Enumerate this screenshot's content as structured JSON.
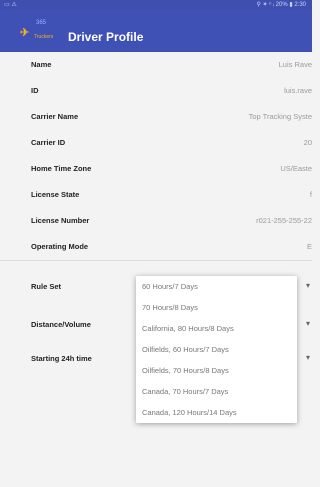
{
  "status_bar": {
    "left": "▭ ⚠",
    "right": "⚲ ✶ ⁿ ᵢ 20% ▮ 2:30"
  },
  "app_bar": {
    "title": "Driver Profile",
    "logo": {
      "top_text": "365",
      "bottom_text": "Truckers"
    }
  },
  "profile_rows": [
    {
      "label": "Name",
      "value": "Luis Rave"
    },
    {
      "label": "ID",
      "value": "luis.rave"
    },
    {
      "label": "Carrier Name",
      "value": "Top Tracking Syste"
    },
    {
      "label": "Carrier ID",
      "value": "20"
    },
    {
      "label": "Home Time Zone",
      "value": "US/Easte"
    },
    {
      "label": "License State",
      "value": "f"
    },
    {
      "label": "License Number",
      "value": "r021-255-255-22"
    },
    {
      "label": "Operating Mode",
      "value": "E"
    }
  ],
  "select_rows": [
    {
      "label": "Rule Set",
      "chevron": "▾"
    },
    {
      "label": "Distance/Volume",
      "chevron": "▾"
    },
    {
      "label": "Starting 24h time",
      "chevron": "▾"
    }
  ],
  "rule_set_options": [
    "60 Hours/7 Days",
    "70 Hours/8 Days",
    "California, 80 Hours/8 Days",
    "Oilfields, 60 Hours/7 Days",
    "Oilfields, 70 Hours/8 Days",
    "Canada, 70 Hours/7 Days",
    "Canada, 120 Hours/14 Days"
  ],
  "icons": {
    "logo": "truck-bird-logo-icon",
    "chevron": "chevron-down-icon"
  },
  "colors": {
    "app_bar": "#3f51b5",
    "accent": "#f2b01e"
  }
}
